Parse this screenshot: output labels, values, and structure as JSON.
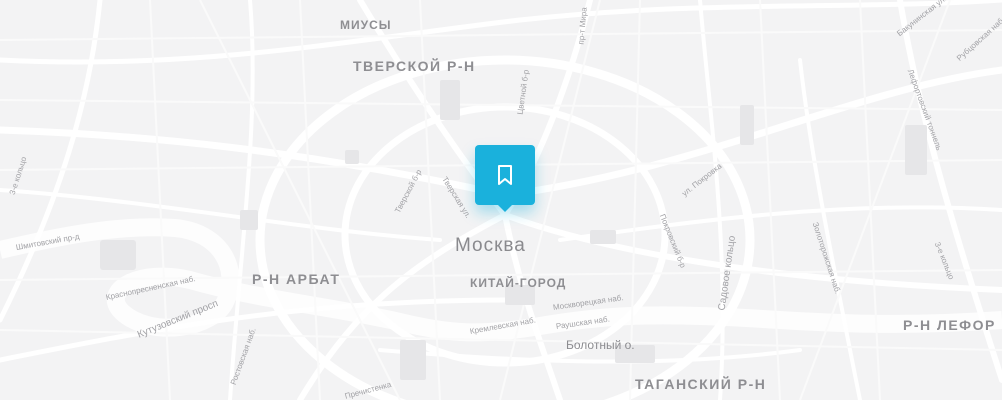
{
  "map": {
    "districts": {
      "miusy": "МИУСЫ",
      "tverskoy": "ТВЕРСКОЙ Р-Н",
      "arbat": "Р-Н АРБАТ",
      "kitai_gorod": "КИТАЙ-ГОРОД",
      "tagansky": "ТАГАНСКИЙ Р-Н",
      "lefortovo": "Р-Н ЛЕФОР"
    },
    "city": "Москва",
    "places": {
      "bolotny": "Болотный о."
    },
    "streets": {
      "third_ring_left": "3-е кольцо",
      "shmitovsky": "Шмитовский пр-д",
      "krasnopresnenskaya": "Краснопресненская наб.",
      "kutuzovsky": "Кутузовский просп",
      "tverskoy_bul": "Тверской б-р",
      "tverskaya": "Тверская ул.",
      "tsvetnoy": "Цветной б-р",
      "prosp_mira": "пр-т Мира",
      "pokrovka": "ул. Покровка",
      "pokrovsky_bul": "Покровский б-р",
      "sadovoe": "Садовое кольцо",
      "kremlevskaya": "Кремлевская наб.",
      "moskvoretskaya": "Москворецкая наб.",
      "raushskaya": "Раушская наб.",
      "lefortovsky_tunnel": "Лефортовский тоннель",
      "third_ring_right": "3-е кольцо",
      "bakuninskaya": "Бакунинская ул.",
      "rubtsovskaya": "Рубцовская наб.",
      "zolotorozhskaya": "Золоторожская наб.",
      "rostovskaya": "Ростовская наб.",
      "prechistenka": "Пречистенка"
    },
    "marker": {
      "icon": "bookmark-icon",
      "color": "#1ab1dc"
    }
  }
}
